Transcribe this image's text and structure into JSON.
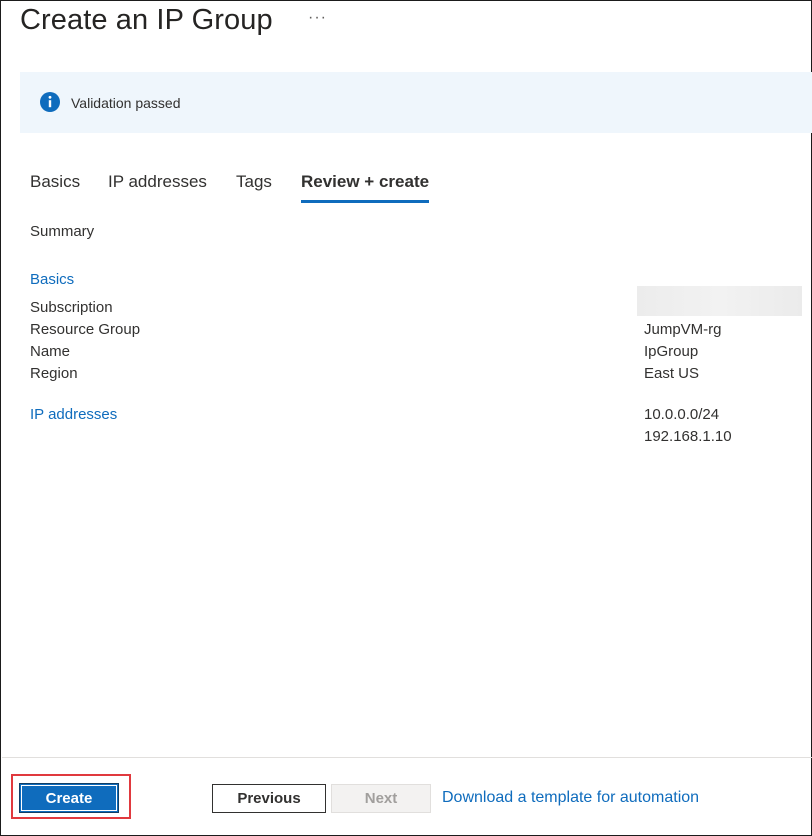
{
  "header": {
    "title": "Create an IP Group",
    "more_label": "···"
  },
  "banner": {
    "icon": "info-icon",
    "text": "Validation passed",
    "accent": "#0f6cbd"
  },
  "tabs": [
    {
      "label": "Basics",
      "active": false
    },
    {
      "label": "IP addresses",
      "active": false
    },
    {
      "label": "Tags",
      "active": false
    },
    {
      "label": "Review + create",
      "active": true
    }
  ],
  "summary": {
    "heading": "Summary",
    "basics": {
      "section_label": "Basics",
      "rows": [
        {
          "label": "Subscription",
          "value": ""
        },
        {
          "label": "Resource Group",
          "value": "JumpVM-rg"
        },
        {
          "label": "Name",
          "value": "IpGroup"
        },
        {
          "label": "Region",
          "value": "East US"
        }
      ]
    },
    "ip_addresses": {
      "section_label": "IP addresses",
      "values": [
        "10.0.0.0/24",
        "192.168.1.10"
      ]
    }
  },
  "footer": {
    "create_label": "Create",
    "previous_label": "Previous",
    "next_label": "Next",
    "download_label": "Download a template for automation"
  },
  "colors": {
    "primary": "#0f6cbd",
    "banner_bg": "#eff6fc",
    "highlight": "#e0393e"
  }
}
